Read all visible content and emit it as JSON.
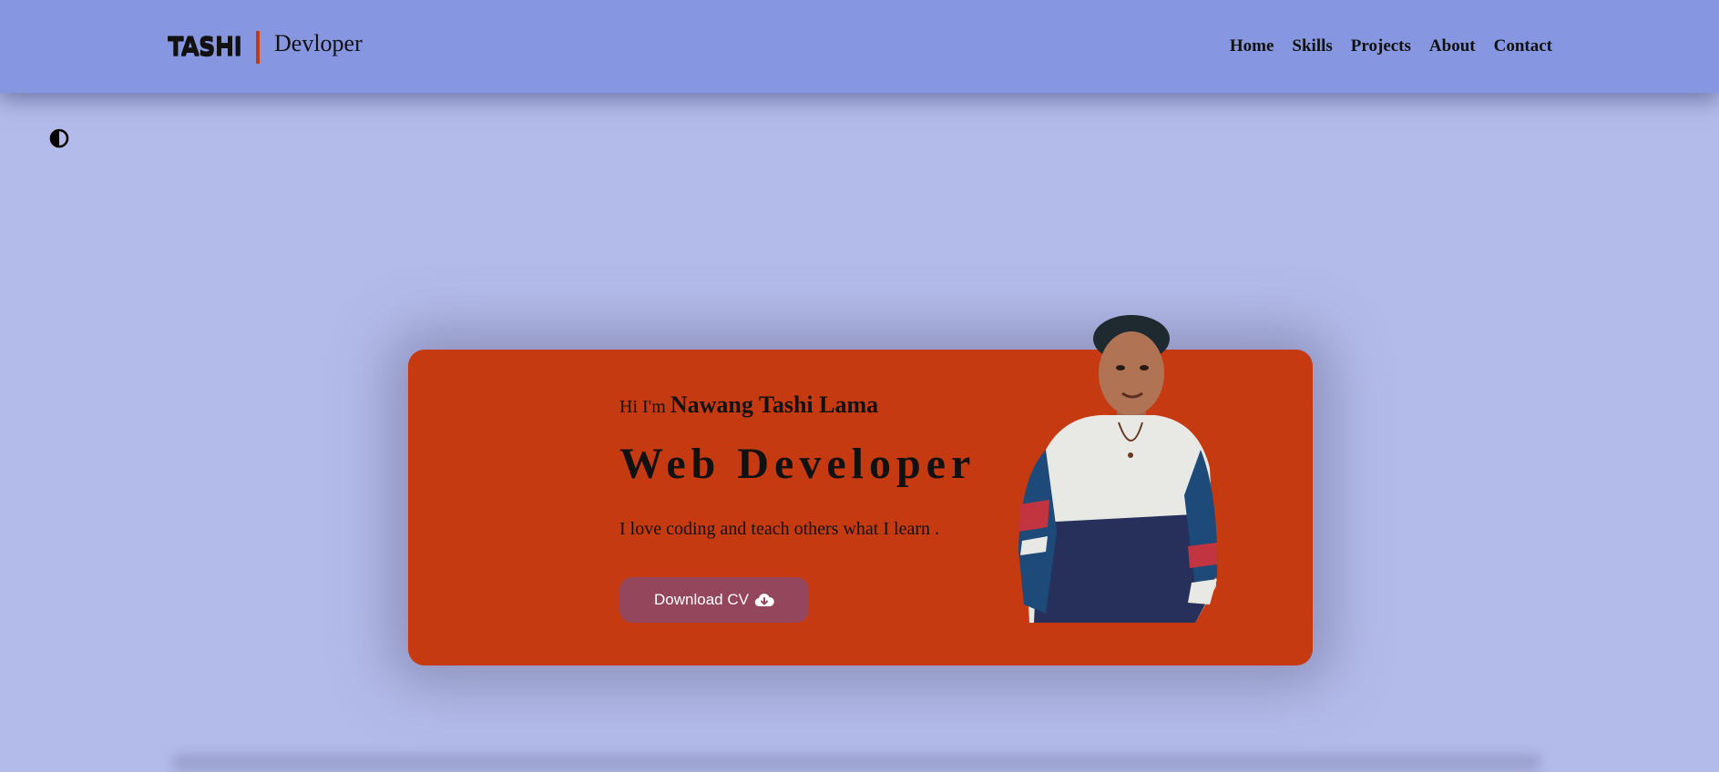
{
  "header": {
    "logo_text": "TASHI",
    "logo_subtitle": "Devloper",
    "nav": [
      "Home",
      "Skills",
      "Projects",
      "About",
      "Contact"
    ]
  },
  "theme_toggle": {
    "icon": "contrast-half-icon"
  },
  "hero": {
    "greeting_prefix": "Hi I'm",
    "name": "Nawang Tashi Lama",
    "role": "Web Developer",
    "tagline": "I love coding and teach others what I learn .",
    "cta_label": "Download CV",
    "cta_icon": "cloud-download-icon"
  },
  "colors": {
    "background": "#b3bbea",
    "navbar": "#8796e0",
    "card": "#c63a12",
    "accent_bar": "#c63a12",
    "button": "#94475c"
  }
}
